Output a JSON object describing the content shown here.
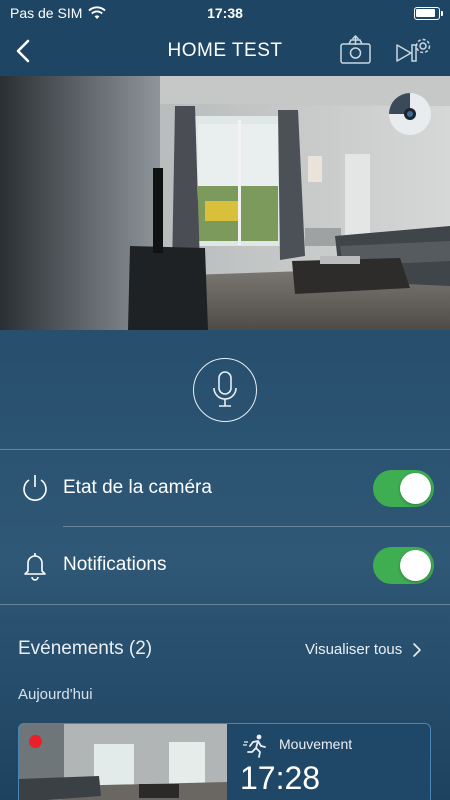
{
  "status_bar": {
    "carrier": "Pas de SIM",
    "time": "17:38",
    "icons": [
      "wifi-icon",
      "battery-icon"
    ]
  },
  "header": {
    "title": "HOME TEST",
    "icons": [
      "back-chevron-icon",
      "camera-snapshot-icon",
      "video-settings-icon"
    ]
  },
  "camera_view": {
    "icons": [
      "lens-privacy-icon"
    ]
  },
  "audio": {
    "icon": "microphone-icon"
  },
  "settings": {
    "camera_state": {
      "label": "Etat de la caméra",
      "icon": "power-icon",
      "enabled": true
    },
    "notifications": {
      "label": "Notifications",
      "icon": "bell-icon",
      "enabled": true
    }
  },
  "events": {
    "title": "Evénements (2)",
    "see_all_label": "Visualiser tous",
    "day_label": "Aujourd'hui",
    "items": [
      {
        "type": "Mouvement",
        "time": "17:28",
        "icon": "running-person-icon",
        "unread": true
      }
    ]
  },
  "colors": {
    "header_bg": "#1e4664",
    "toggle_on": "#3fae53",
    "event_border": "#4a86b5",
    "unread_dot": "#e8202a"
  }
}
